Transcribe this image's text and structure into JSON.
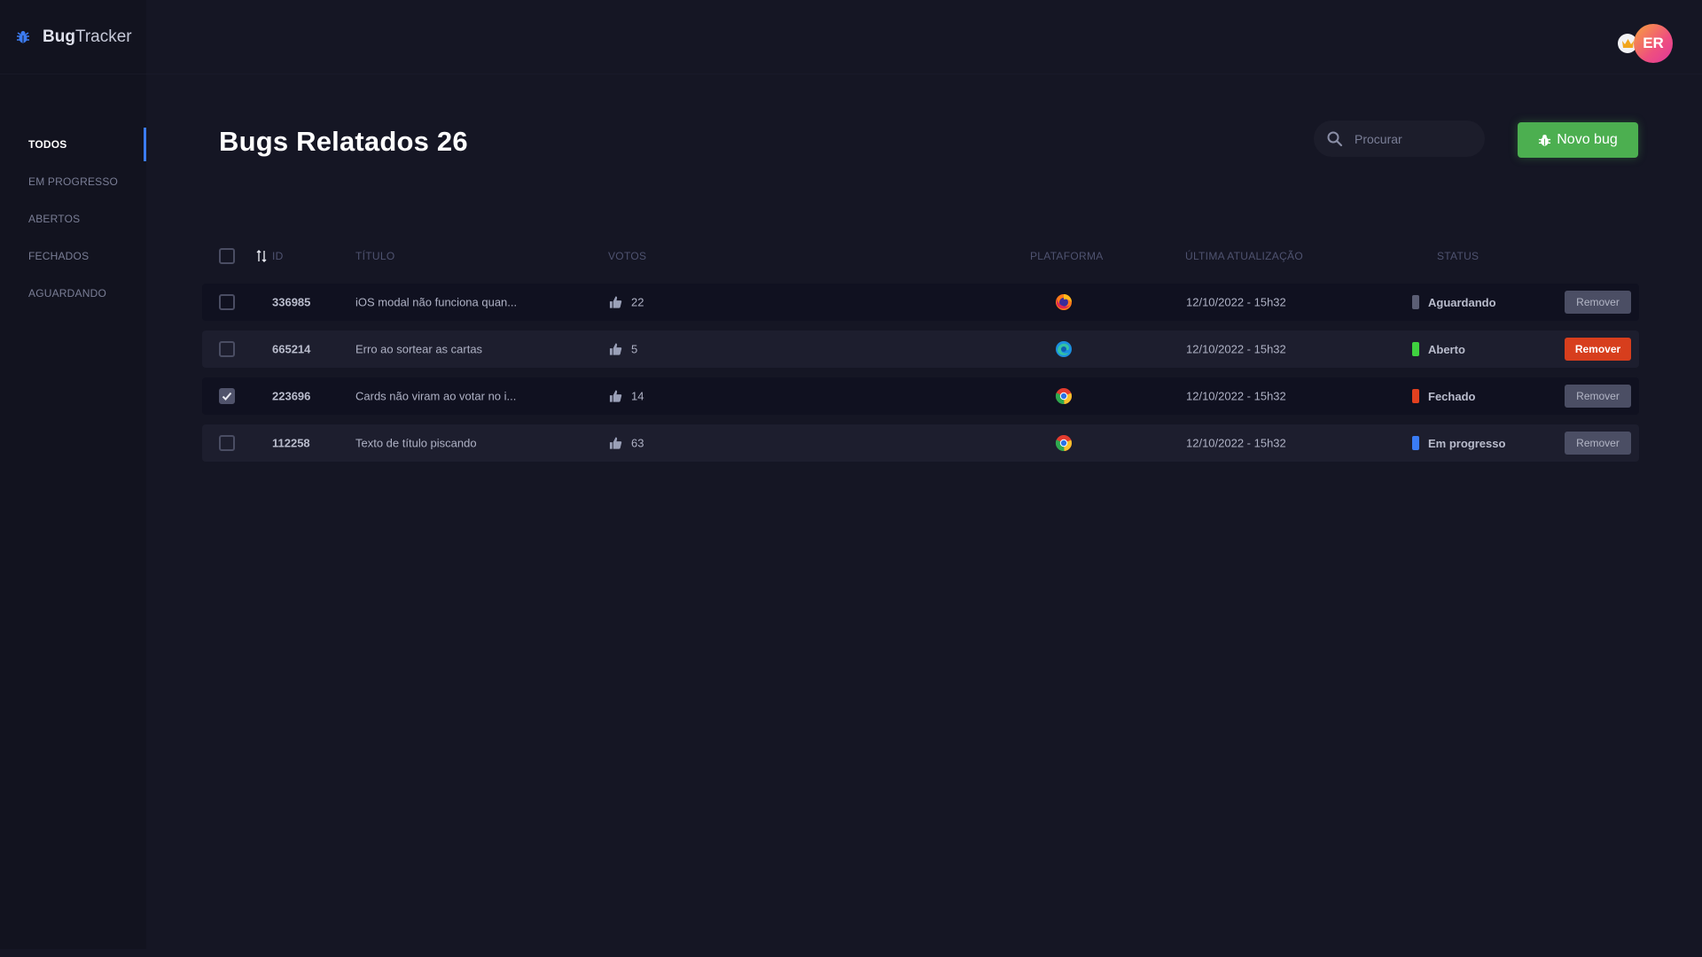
{
  "brand": {
    "bold": "Bug",
    "rest": "Tracker"
  },
  "sidebar": {
    "items": [
      {
        "label": "TODOS",
        "active": true
      },
      {
        "label": "EM PROGRESSO",
        "active": false
      },
      {
        "label": "ABERTOS",
        "active": false
      },
      {
        "label": "FECHADOS",
        "active": false
      },
      {
        "label": "AGUARDANDO",
        "active": false
      }
    ]
  },
  "user": {
    "initials": "ER",
    "badge_icon": "crown-icon"
  },
  "header": {
    "title": "Bugs Relatados 26",
    "search_placeholder": "Procurar",
    "new_bug_label": "Novo bug"
  },
  "table": {
    "columns": {
      "id": "ID",
      "title": "TÍTULO",
      "votes": "VOTOS",
      "platform": "PLATAFORMA",
      "updated": "ÚLTIMA ATUALIZAÇÃO",
      "status": "STATUS"
    },
    "rows": [
      {
        "checked": false,
        "id": "336985",
        "title": "iOS modal não funciona quan...",
        "votes": "22",
        "platform": "firefox-icon",
        "updated": "12/10/2022 - 15h32",
        "status": "Aguardando",
        "status_color": "#5b5e74",
        "remove_label": "Remover",
        "remove_style": "muted"
      },
      {
        "checked": false,
        "id": "665214",
        "title": "Erro ao sortear as cartas",
        "votes": "5",
        "platform": "edge-icon",
        "updated": "12/10/2022 - 15h32",
        "status": "Aberto",
        "status_color": "#3fd13f",
        "remove_label": "Remover",
        "remove_style": "danger"
      },
      {
        "checked": true,
        "id": "223696",
        "title": "Cards não viram ao votar no i...",
        "votes": "14",
        "platform": "chrome-icon",
        "updated": "12/10/2022 - 15h32",
        "status": "Fechado",
        "status_color": "#e2401f",
        "remove_label": "Remover",
        "remove_style": "muted"
      },
      {
        "checked": false,
        "id": "112258",
        "title": "Texto de título piscando",
        "votes": "63",
        "platform": "chrome-icon",
        "updated": "12/10/2022 - 15h32",
        "status": "Em progresso",
        "status_color": "#3a7cf5",
        "remove_label": "Remover",
        "remove_style": "muted"
      }
    ]
  },
  "colors": {
    "accent": "#3c7cf2",
    "primary_button": "#4caf50",
    "danger_button": "#d73e1d"
  }
}
